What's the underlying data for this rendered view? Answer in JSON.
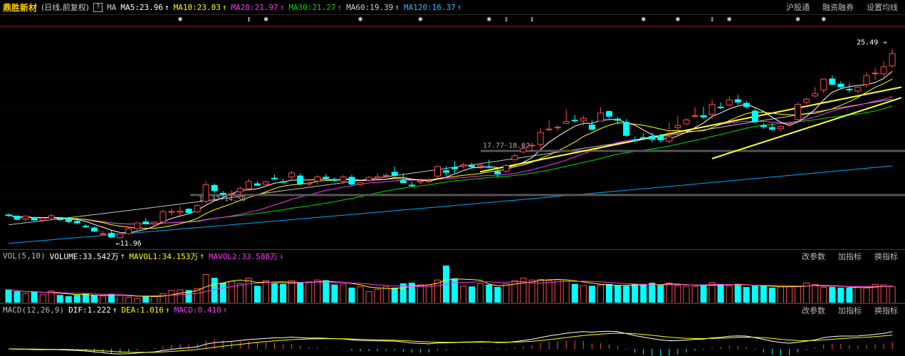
{
  "header": {
    "stock_name": "鼎胜新材",
    "cycle": "(日线,前复权)",
    "help": "?",
    "ma_label": "MA",
    "ma5": "MA5:23.96",
    "ma10": "MA10:23.03",
    "ma20": "MA20:21.97",
    "ma30": "MA30:21.27",
    "ma60": "MA60:19.39",
    "ma120": "MA120:16.37",
    "buttons": [
      "沪股通",
      "融资融券",
      "设置均线"
    ]
  },
  "price_chart": {
    "y_range": [
      11.0,
      26.6
    ],
    "x_count": 104,
    "high_label": "25.49",
    "low_label": "11.96",
    "marker_label_1": "14.37-14.59",
    "marker_label_2": "17.77-18.02",
    "event_star_indices": [
      20,
      28,
      30,
      41,
      48,
      56,
      58,
      61,
      74,
      78,
      82,
      84,
      92,
      95
    ],
    "ohlc": [
      [
        12.95,
        13.06,
        12.8,
        12.93
      ],
      [
        12.86,
        12.9,
        12.56,
        12.61
      ],
      [
        12.64,
        12.87,
        12.47,
        12.86
      ],
      [
        12.72,
        12.82,
        12.49,
        12.56
      ],
      [
        12.55,
        12.71,
        12.48,
        12.7
      ],
      [
        12.71,
        13.06,
        12.64,
        12.88
      ],
      [
        12.66,
        12.78,
        12.5,
        12.58
      ],
      [
        12.66,
        12.8,
        12.33,
        12.44
      ],
      [
        12.46,
        12.72,
        12.22,
        12.34
      ],
      [
        12.1,
        12.25,
        11.99,
        12.05
      ],
      [
        11.96,
        12.08,
        11.65,
        11.72
      ],
      [
        11.53,
        11.74,
        11.45,
        11.53
      ],
      [
        11.56,
        11.74,
        11.2,
        11.27
      ],
      [
        11.22,
        11.65,
        11.16,
        11.52
      ],
      [
        11.53,
        12.02,
        11.48,
        11.9
      ],
      [
        11.9,
        12.38,
        11.7,
        12.34
      ],
      [
        12.42,
        12.7,
        12.24,
        12.27
      ],
      [
        12.28,
        12.45,
        12.11,
        12.4
      ],
      [
        12.42,
        13.32,
        12.41,
        13.19
      ],
      [
        13.15,
        13.4,
        12.91,
        13.21
      ],
      [
        13.15,
        13.6,
        12.75,
        13.23
      ],
      [
        13.38,
        13.45,
        12.98,
        13.12
      ],
      [
        13.18,
        13.75,
        13.1,
        13.65
      ],
      [
        13.98,
        15.5,
        13.78,
        15.22
      ],
      [
        15.18,
        15.32,
        14.62,
        14.79
      ],
      [
        14.58,
        14.75,
        14.31,
        14.5
      ],
      [
        14.49,
        14.79,
        14.21,
        14.54
      ],
      [
        14.68,
        15.1,
        14.42,
        14.94
      ],
      [
        14.92,
        15.67,
        14.75,
        15.47
      ],
      [
        15.3,
        15.52,
        15.11,
        15.18
      ],
      [
        15.26,
        15.52,
        15.1,
        15.44
      ],
      [
        15.72,
        16.0,
        15.6,
        15.69
      ],
      [
        15.46,
        15.68,
        15.35,
        15.42
      ],
      [
        15.82,
        16.28,
        15.55,
        16.11
      ],
      [
        15.89,
        16.09,
        15.2,
        15.31
      ],
      [
        15.28,
        15.49,
        15.13,
        15.35
      ],
      [
        15.5,
        15.96,
        15.24,
        15.82
      ],
      [
        15.8,
        16.04,
        15.58,
        15.72
      ],
      [
        15.63,
        15.78,
        15.46,
        15.56
      ],
      [
        15.5,
        15.94,
        15.3,
        15.81
      ],
      [
        15.79,
        15.98,
        15.15,
        15.27
      ],
      [
        15.25,
        15.44,
        15.11,
        15.38
      ],
      [
        15.58,
        15.88,
        15.49,
        15.78
      ],
      [
        15.74,
        16.08,
        15.55,
        15.83
      ],
      [
        15.89,
        16.12,
        15.73,
        15.93
      ],
      [
        16.17,
        16.6,
        15.85,
        15.94
      ],
      [
        15.55,
        16.09,
        15.37,
        15.38
      ],
      [
        15.2,
        15.47,
        15.09,
        15.17
      ],
      [
        15.43,
        15.68,
        15.26,
        15.51
      ],
      [
        15.46,
        15.77,
        15.37,
        15.52
      ],
      [
        15.88,
        16.66,
        15.69,
        16.6
      ],
      [
        16.29,
        16.63,
        15.93,
        16.16
      ],
      [
        16.53,
        17.03,
        16.1,
        16.43
      ],
      [
        16.64,
        16.91,
        16.45,
        16.73
      ],
      [
        16.68,
        16.88,
        16.44,
        16.58
      ],
      [
        16.61,
        16.84,
        16.42,
        16.7
      ],
      [
        16.59,
        17.11,
        16.45,
        16.55
      ],
      [
        16.22,
        16.43,
        15.77,
        16.04
      ],
      [
        16.24,
        16.81,
        16.13,
        16.67
      ],
      [
        17.11,
        17.59,
        17.06,
        17.41
      ],
      [
        17.71,
        18.3,
        17.6,
        17.98
      ],
      [
        18.18,
        18.41,
        17.75,
        18.21
      ],
      [
        18.28,
        19.48,
        18.03,
        19.17
      ],
      [
        19.39,
        20.08,
        19.3,
        19.43
      ],
      [
        19.53,
        19.74,
        19.27,
        19.57
      ],
      [
        19.86,
        20.9,
        19.84,
        20.01
      ],
      [
        20.1,
        20.5,
        19.91,
        20.06
      ],
      [
        20.04,
        20.45,
        19.68,
        20.25
      ],
      [
        19.74,
        20.1,
        19.3,
        19.41
      ],
      [
        20.03,
        21.09,
        20.02,
        20.64
      ],
      [
        20.76,
        20.84,
        20.22,
        20.4
      ],
      [
        20.19,
        20.36,
        19.8,
        20.09
      ],
      [
        19.95,
        20.18,
        18.84,
        18.95
      ],
      [
        18.61,
        18.86,
        18.49,
        18.57
      ],
      [
        18.79,
        19.1,
        18.58,
        18.78
      ],
      [
        18.88,
        19.16,
        18.44,
        18.66
      ],
      [
        18.93,
        19.09,
        18.42,
        18.61
      ],
      [
        18.52,
        19.88,
        18.37,
        18.84
      ],
      [
        19.54,
        20.4,
        18.94,
        19.7
      ],
      [
        19.82,
        20.27,
        19.74,
        20.12
      ],
      [
        20.43,
        21.08,
        20.27,
        20.45
      ],
      [
        20.45,
        21.1,
        20.19,
        20.34
      ],
      [
        20.55,
        21.66,
        20.2,
        21.29
      ],
      [
        21.09,
        21.45,
        20.96,
        21.06
      ],
      [
        21.25,
        21.9,
        21.19,
        21.64
      ],
      [
        21.65,
        22.01,
        21.25,
        21.47
      ],
      [
        21.38,
        21.56,
        20.98,
        21.12
      ],
      [
        20.79,
        20.98,
        19.87,
        19.98
      ],
      [
        19.7,
        19.86,
        19.44,
        19.61
      ],
      [
        19.55,
        19.87,
        19.29,
        19.41
      ],
      [
        19.45,
        19.7,
        19.26,
        19.62
      ],
      [
        19.83,
        20.0,
        19.6,
        19.9
      ],
      [
        20.16,
        21.44,
        19.96,
        21.29
      ],
      [
        21.46,
        21.82,
        21.29,
        21.69
      ],
      [
        21.93,
        22.6,
        21.82,
        22.1
      ],
      [
        22.38,
        23.25,
        22.14,
        23.21
      ],
      [
        23.22,
        23.5,
        22.74,
        22.81
      ],
      [
        22.83,
        23.05,
        22.41,
        22.62
      ],
      [
        22.44,
        22.89,
        22.18,
        22.41
      ],
      [
        22.3,
        22.63,
        22.14,
        22.59
      ],
      [
        22.79,
        23.74,
        22.58,
        23.47
      ],
      [
        23.61,
        24.08,
        23.16,
        23.66
      ],
      [
        23.6,
        24.53,
        23.36,
        24.14
      ],
      [
        24.21,
        25.49,
        24.06,
        25.14
      ]
    ]
  },
  "volume_panel": {
    "label": "VOL(5,10)",
    "volume": "VOLUME:33.542万",
    "mavol1": "MAVOL1:34.153万",
    "mavol2": "MAVOL2:33.588万",
    "buttons": [
      "改参数",
      "加指标",
      "换指标"
    ],
    "values": [
      22,
      19,
      16,
      19,
      14,
      20,
      13,
      11,
      13,
      15,
      13,
      12,
      15,
      13,
      10,
      8,
      12,
      12,
      16,
      21,
      22,
      21,
      24,
      47,
      41,
      33,
      36,
      32,
      41,
      28,
      37,
      32,
      31,
      37,
      34,
      35,
      38,
      37,
      30,
      32,
      25,
      27,
      19,
      23,
      27,
      25,
      32,
      33,
      30,
      30,
      38,
      61,
      40,
      28,
      27,
      32,
      30,
      26,
      32,
      37,
      41,
      38,
      39,
      37,
      39,
      38,
      31,
      29,
      28,
      30,
      31,
      29,
      28,
      31,
      31,
      33,
      30,
      33,
      29,
      28,
      27,
      30,
      34,
      31,
      29,
      31,
      26,
      28,
      29,
      25,
      27,
      27,
      28,
      33,
      31,
      26,
      26,
      25,
      25,
      27,
      25,
      31,
      30,
      27
    ]
  },
  "macd_panel": {
    "label": "MACD(12,26,9)",
    "dif": "DIF:1.222",
    "dea": "DEA:1.016",
    "macd": "MACD:0.410",
    "buttons": [
      "改参数",
      "加指标",
      "换指标"
    ]
  },
  "colors": {
    "up": "#ff4a4a",
    "down": "#00ffff",
    "ma5": "#ffffff",
    "ma10": "#ffff00",
    "ma20": "#ff33ff",
    "ma30": "#00dd00",
    "ma60": "#c0c0c0",
    "ma120": "#00a8ff",
    "trend": "#ffff33"
  }
}
